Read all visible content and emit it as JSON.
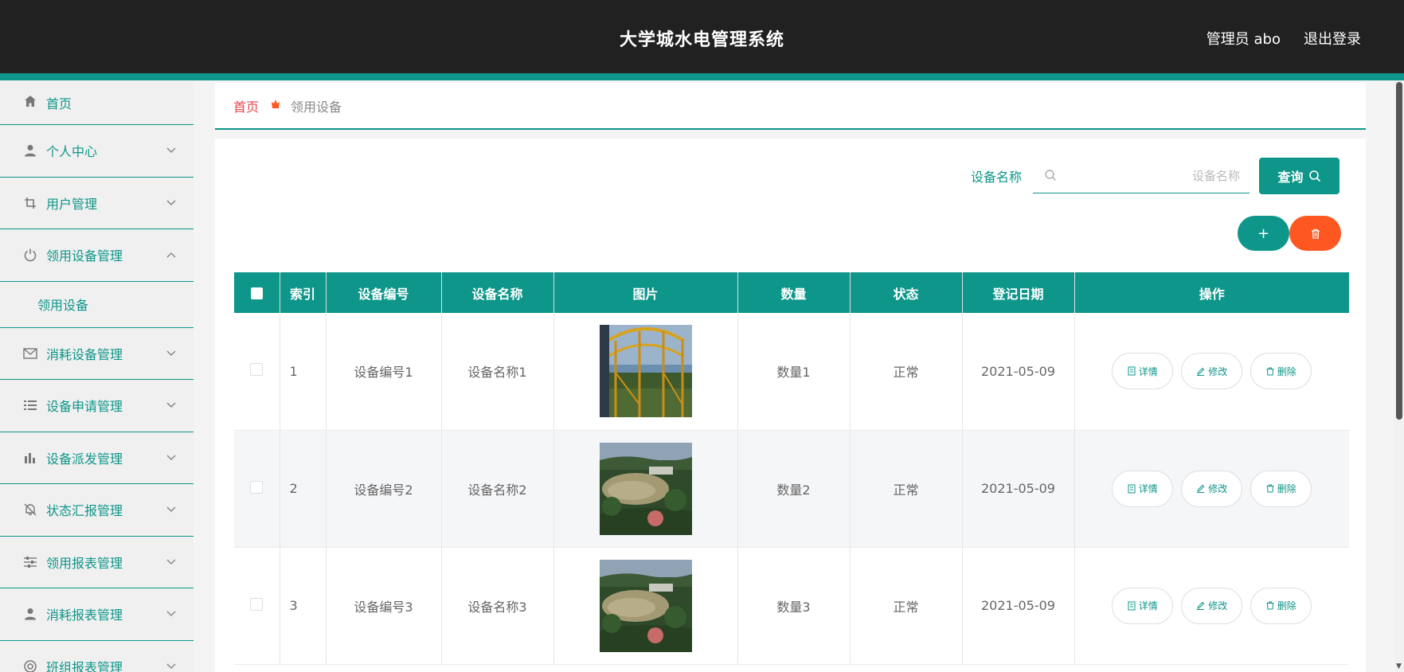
{
  "header": {
    "title": "大学城水电管理系统",
    "user": "管理员 abo",
    "logout": "退出登录"
  },
  "sidebar": {
    "items": [
      {
        "label": "首页",
        "icon": "home-icon"
      },
      {
        "label": "个人中心",
        "icon": "user-icon"
      },
      {
        "label": "用户管理",
        "icon": "crop-icon"
      },
      {
        "label": "领用设备管理",
        "icon": "power-icon",
        "submenu": [
          "领用设备"
        ]
      },
      {
        "label": "消耗设备管理",
        "icon": "mail-icon"
      },
      {
        "label": "设备申请管理",
        "icon": "list-icon"
      },
      {
        "label": "设备派发管理",
        "icon": "bar-chart-icon"
      },
      {
        "label": "状态汇报管理",
        "icon": "bell-off-icon"
      },
      {
        "label": "领用报表管理",
        "icon": "sliders-icon"
      },
      {
        "label": "消耗报表管理",
        "icon": "user-icon"
      },
      {
        "label": "班组报表管理",
        "icon": "circle-icon"
      }
    ]
  },
  "breadcrumb": {
    "home": "首页",
    "current": "领用设备"
  },
  "search": {
    "label": "设备名称",
    "placeholder": "设备名称",
    "value": "",
    "button": "查询"
  },
  "actions": {
    "add": "+"
  },
  "table": {
    "headers": [
      "索引",
      "设备编号",
      "设备名称",
      "图片",
      "数量",
      "状态",
      "登记日期",
      "操作"
    ],
    "rows": [
      {
        "index": "1",
        "code": "设备编号1",
        "name": "设备名称1",
        "image": "roller-coaster-photo",
        "qty": "数量1",
        "status": "正常",
        "date": "2021-05-09"
      },
      {
        "index": "2",
        "code": "设备编号2",
        "name": "设备名称2",
        "image": "park-lake-photo",
        "qty": "数量2",
        "status": "正常",
        "date": "2021-05-09"
      },
      {
        "index": "3",
        "code": "设备编号3",
        "name": "设备名称3",
        "image": "park-lake-photo",
        "qty": "数量3",
        "status": "正常",
        "date": "2021-05-09"
      }
    ],
    "row_buttons": {
      "detail": "详情",
      "edit": "修改",
      "delete": "删除"
    }
  },
  "colors": {
    "primary": "#0e968a",
    "danger": "#ff5722",
    "header_bg": "#212121",
    "breadcrumb_home": "#e8424b"
  }
}
